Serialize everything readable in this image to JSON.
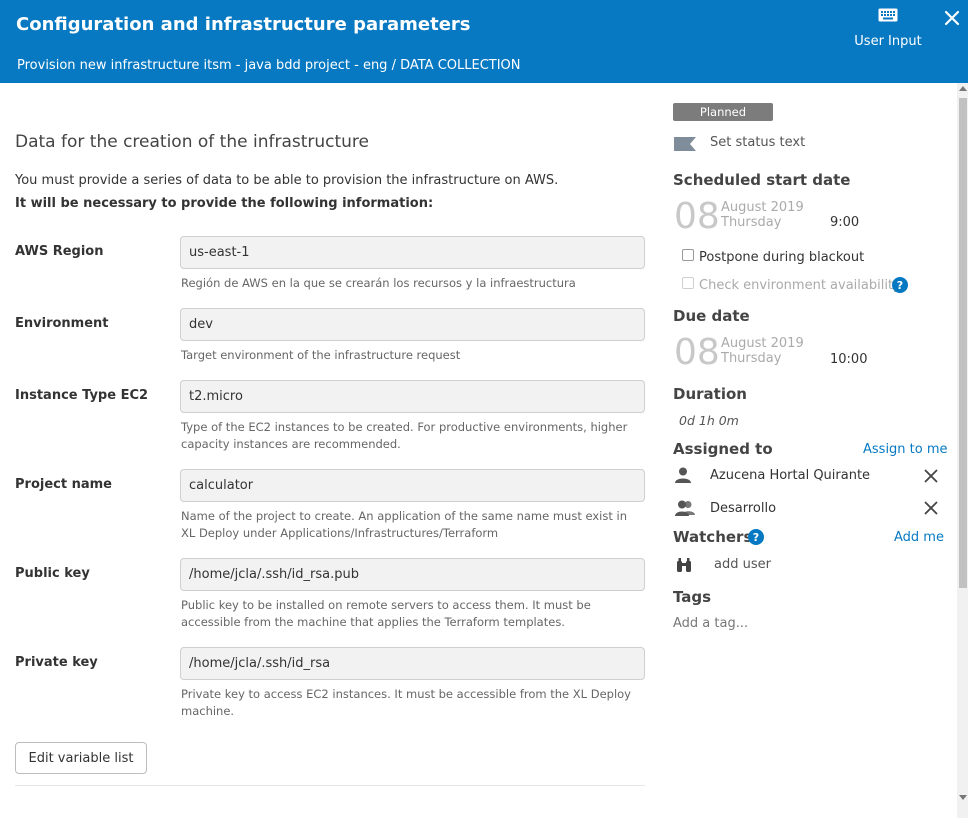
{
  "header": {
    "title": "Configuration and infrastructure parameters",
    "breadcrumb": "Provision new infrastructure itsm - java bdd project - eng / DATA COLLECTION",
    "user_input_label": "User Input",
    "user_input_icon": "keyboard-icon",
    "close_icon": "close-icon",
    "background_color": "#0779c2"
  },
  "form": {
    "section_title": "Data for the creation of the infrastructure",
    "intro_line1": "You must provide a series of data to be able to provision the infrastructure on AWS.",
    "intro_line2": "It will be necessary to provide the following information:",
    "fields": [
      {
        "label": "AWS Region",
        "value": "us-east-1",
        "help": "Región de AWS en la que se crearán los recursos y la infraestructura"
      },
      {
        "label": "Environment",
        "value": "dev",
        "help": "Target environment of the infrastructure request"
      },
      {
        "label": "Instance Type EC2",
        "value": "t2.micro",
        "help": "Type of the EC2 instances to be created. For productive environments, higher capacity instances are recommended."
      },
      {
        "label": "Project name",
        "value": "calculator",
        "help": "Name of the project to create. An application of the same name must exist in XL Deploy under Applications/Infrastructures/Terraform"
      },
      {
        "label": "Public key",
        "value": "/home/jcla/.ssh/id_rsa.pub",
        "help": "Public key to be installed on remote servers to access them. It must be accessible from the machine that applies the Terraform templates."
      },
      {
        "label": "Private key",
        "value": "/home/jcla/.ssh/id_rsa",
        "help": "Private key to access EC2 instances. It must be accessible from the XL Deploy machine."
      }
    ],
    "edit_button_label": "Edit variable list"
  },
  "sidebar": {
    "status": "Planned",
    "status_color": "#7c7c7c",
    "set_status_text": "Set status text",
    "scheduled_start": {
      "heading": "Scheduled start date",
      "day": "08",
      "month_year": "August 2019",
      "weekday": "Thursday",
      "time": "9:00"
    },
    "postpone_label": "Postpone during blackout",
    "check_env_label": "Check environment availability",
    "due_date": {
      "heading": "Due date",
      "day": "08",
      "month_year": "August 2019",
      "weekday": "Thursday",
      "time": "10:00"
    },
    "duration": {
      "heading": "Duration",
      "value": "0d 1h 0m"
    },
    "assigned": {
      "heading": "Assigned to",
      "assign_to_me": "Assign to me",
      "user": "Azucena Hortal Quirante",
      "team": "Desarrollo"
    },
    "watchers": {
      "heading": "Watchers",
      "add_me": "Add me",
      "add_user": "add user"
    },
    "tags": {
      "heading": "Tags",
      "placeholder": "Add a tag..."
    },
    "link_color": "#0779c2"
  }
}
